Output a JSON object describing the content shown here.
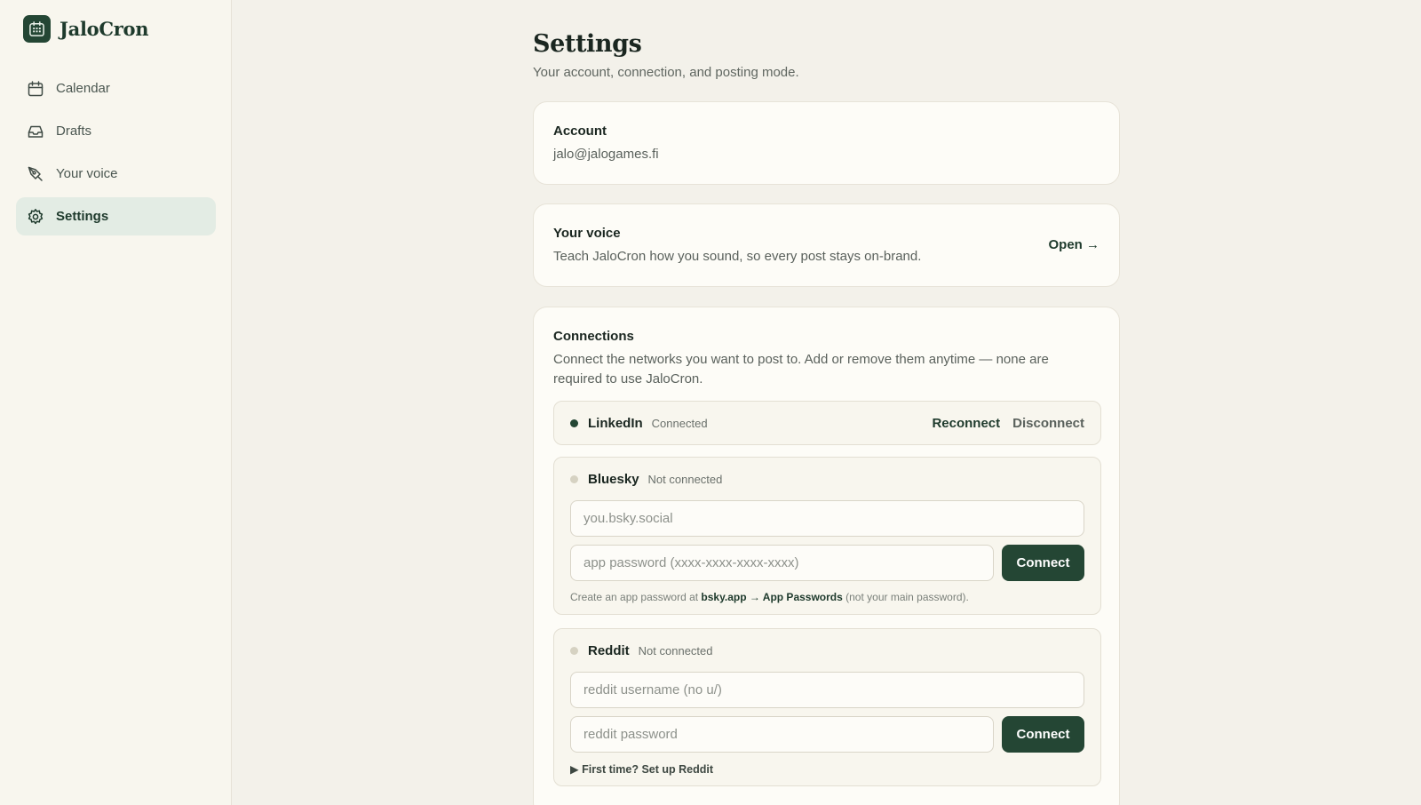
{
  "app": {
    "name": "JaloCron"
  },
  "sidebar": {
    "items": [
      {
        "label": "Calendar",
        "icon": "calendar-icon",
        "active": false
      },
      {
        "label": "Drafts",
        "icon": "inbox-icon",
        "active": false
      },
      {
        "label": "Your voice",
        "icon": "pen-nib-icon",
        "active": false
      },
      {
        "label": "Settings",
        "icon": "gear-icon",
        "active": true
      }
    ]
  },
  "page": {
    "title": "Settings",
    "subtitle": "Your account, connection, and posting mode."
  },
  "account": {
    "title": "Account",
    "email": "jalo@jalogames.fi"
  },
  "voice": {
    "title": "Your voice",
    "description": "Teach JaloCron how you sound, so every post stays on-brand.",
    "open_label": "Open →"
  },
  "connections": {
    "title": "Connections",
    "description": "Connect the networks you want to post to. Add or remove them anytime — none are required to use JaloCron.",
    "linkedin": {
      "name": "LinkedIn",
      "status": "Connected",
      "reconnect_label": "Reconnect",
      "disconnect_label": "Disconnect"
    },
    "bluesky": {
      "name": "Bluesky",
      "status": "Not connected",
      "handle_placeholder": "you.bsky.social",
      "password_placeholder": "app password (xxxx-xxxx-xxxx-xxxx)",
      "connect_label": "Connect",
      "hint_prefix": "Create an app password at ",
      "hint_link": "bsky.app → App Passwords",
      "hint_suffix": " (not your main password)."
    },
    "reddit": {
      "name": "Reddit",
      "status": "Not connected",
      "username_placeholder": "reddit username (no u/)",
      "password_placeholder": "reddit password",
      "connect_label": "Connect",
      "setup_label": "▶ First time? Set up Reddit"
    }
  },
  "colors": {
    "accent": "#244634",
    "background": "#f3f1ea",
    "sidebar": "#f8f6ee",
    "active_nav": "#e3ece4",
    "connected_dot": "#244634",
    "disconnected_dot": "#d6d2c2"
  }
}
